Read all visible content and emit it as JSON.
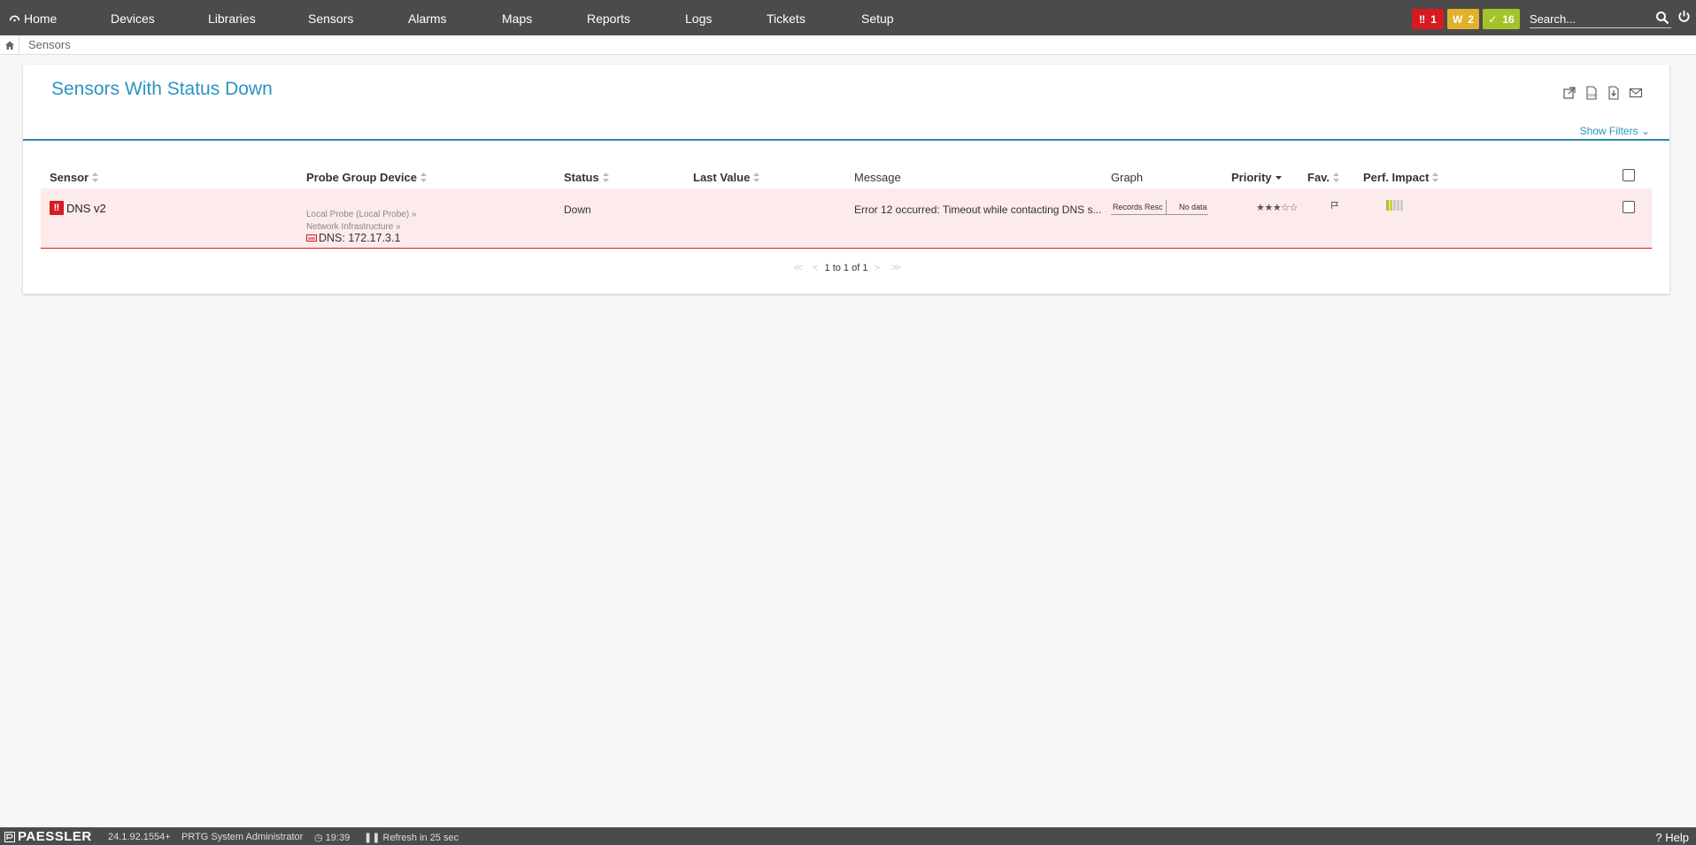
{
  "nav": {
    "home": "Home",
    "devices": "Devices",
    "libraries": "Libraries",
    "sensors": "Sensors",
    "alarms": "Alarms",
    "maps": "Maps",
    "reports": "Reports",
    "logs": "Logs",
    "tickets": "Tickets",
    "setup": "Setup"
  },
  "status_badges": {
    "down": {
      "count": "1",
      "color": "#d71920",
      "icon": "double-exclamation-icon"
    },
    "warning": {
      "label": "W",
      "count": "2",
      "color": "#e1b12c"
    },
    "up": {
      "count": "16",
      "color": "#a4c32b",
      "icon": "check-icon"
    }
  },
  "search": {
    "placeholder": "Search..."
  },
  "breadcrumb": {
    "current": "Sensors"
  },
  "page": {
    "title": "Sensors With Status Down",
    "show_filters": "Show Filters"
  },
  "table": {
    "headers": {
      "sensor": "Sensor",
      "probe_group_device": "Probe Group Device",
      "status": "Status",
      "last_value": "Last Value",
      "message": "Message",
      "graph": "Graph",
      "priority": "Priority",
      "fav": "Fav.",
      "perf_impact": "Perf. Impact"
    },
    "rows": [
      {
        "sensor": "DNS v2",
        "probe": "Local Probe (Local Probe)",
        "group": "Network Infrastructure",
        "device": "DNS: 172.17.3.1",
        "status": "Down",
        "last_value": "",
        "message": "Error 12 occurred: Timeout while contacting DNS s...",
        "graph_channel": "Records Resc",
        "graph_value": "No data",
        "priority": "★★★☆☆",
        "priority_value": 3,
        "perf_impact_level": 0.4
      }
    ]
  },
  "pager": {
    "text": "1 to 1 of 1"
  },
  "footer": {
    "brand": "PAESSLER",
    "version": "24.1.92.1554+",
    "user": "PRTG System Administrator",
    "time": "19:39",
    "refresh": "Refresh in 25 sec",
    "help": "Help"
  },
  "colors": {
    "accent": "#2b94c3",
    "topbar": "#4b4b4b",
    "down_row": "#fdeaea",
    "down": "#d71920"
  }
}
